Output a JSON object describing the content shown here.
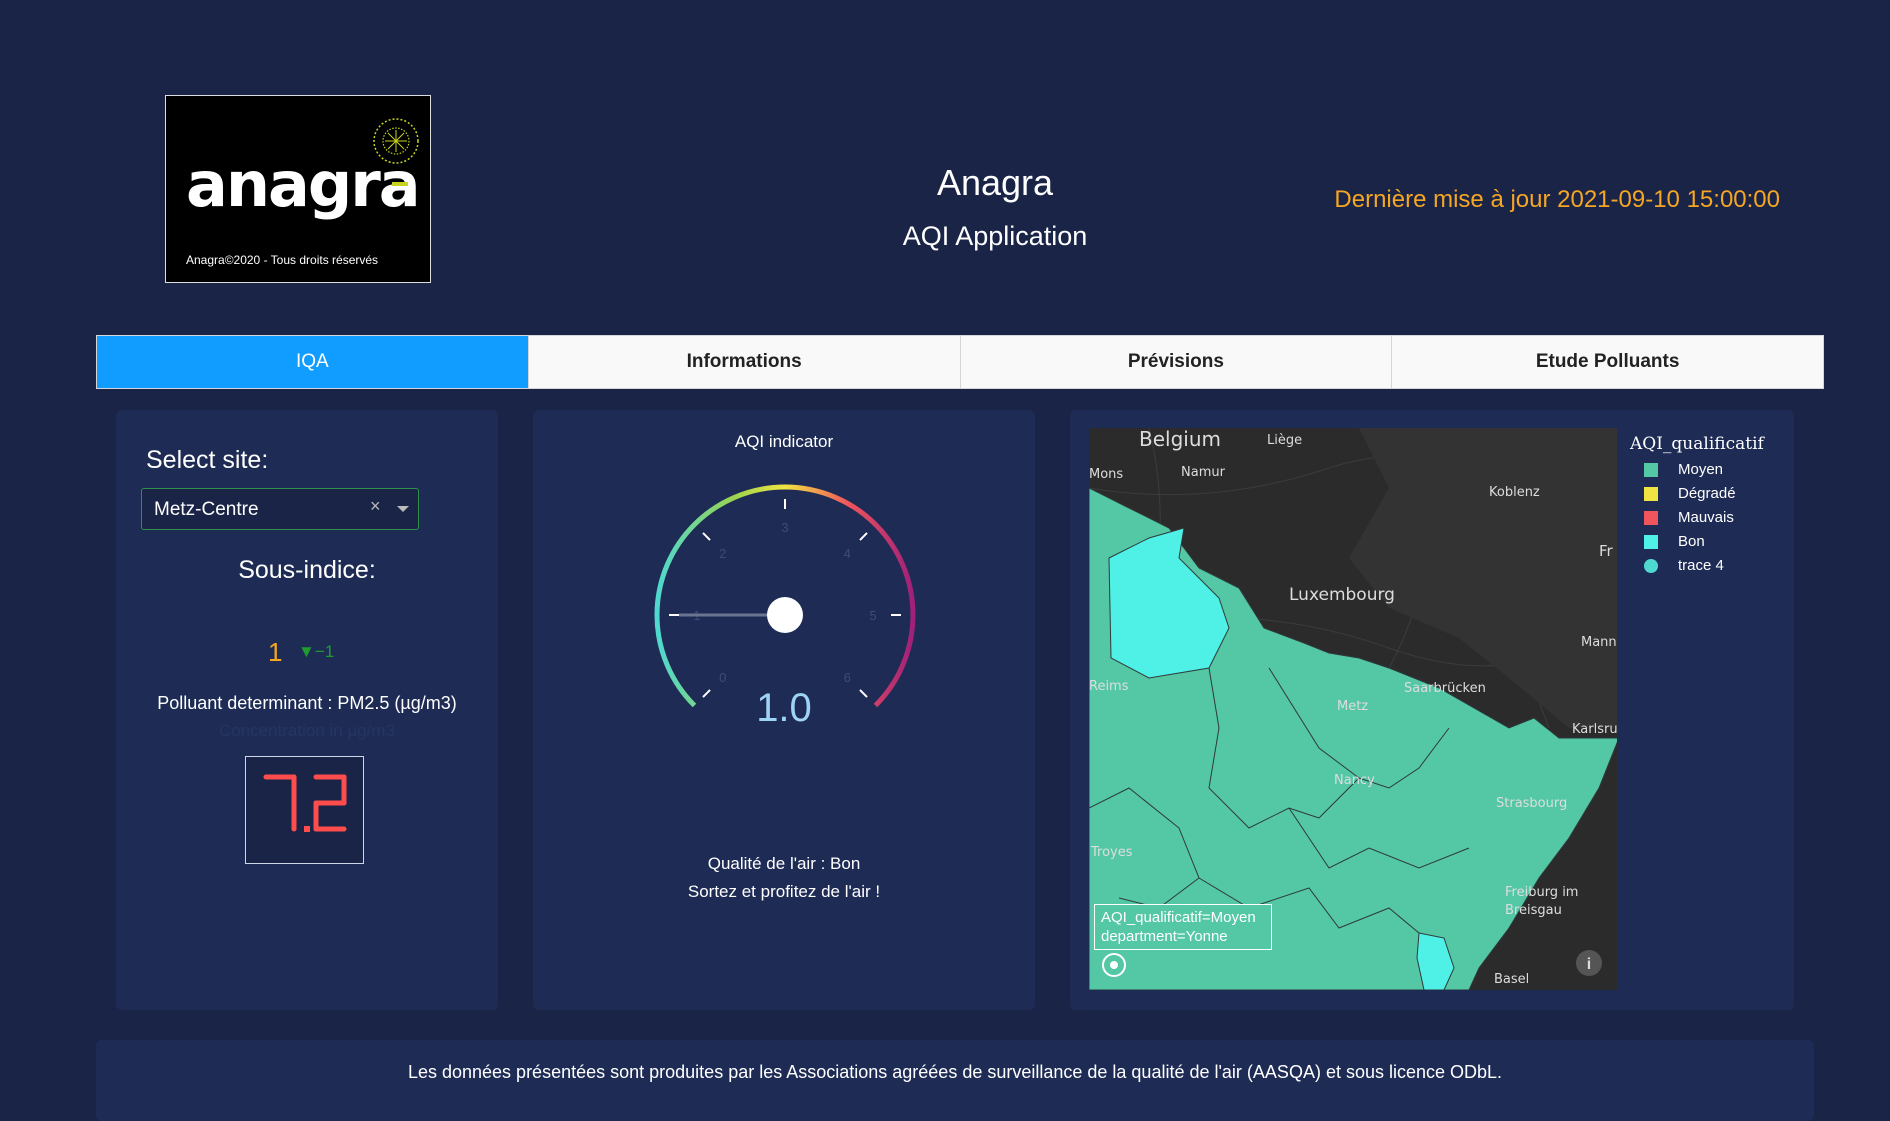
{
  "header": {
    "logo_text": "anagra",
    "logo_copyright": "Anagra©2020 -  Tous droits réservés",
    "title": "Anagra",
    "subtitle": "AQI Application",
    "last_update": "Dernière mise à jour 2021-09-10 15:00:00"
  },
  "tabs": [
    {
      "label": "IQA",
      "active": true
    },
    {
      "label": "Informations",
      "active": false
    },
    {
      "label": "Prévisions",
      "active": false
    },
    {
      "label": "Etude Polluants",
      "active": false
    }
  ],
  "left_panel": {
    "select_label": "Select site:",
    "selected_site": "Metz-Centre",
    "clear_symbol": "×",
    "subindex_label": "Sous-indice:",
    "subindex_value": "1",
    "subindex_delta": "▼−1",
    "pollutant": "Polluant determinant : PM2.5 (µg/m3)",
    "concentration_label": "Concentration in µg/m3",
    "concentration_value": "7.2",
    "led_color": "#ff4d4d"
  },
  "gauge": {
    "title": "AQI indicator",
    "value": 1,
    "value_text": "1.0",
    "min": 0,
    "max": 6,
    "ticks": [
      "0",
      "1",
      "2",
      "3",
      "4",
      "5",
      "6"
    ],
    "quality": "Qualité de l'air : Bon",
    "advice": "Sortez et profitez de l'air !"
  },
  "map": {
    "legend_title": "AQI_qualificatif",
    "legend": [
      {
        "label": "Moyen",
        "color": "#54c7a5",
        "shape": "square"
      },
      {
        "label": "Dégradé",
        "color": "#f0e442",
        "shape": "square"
      },
      {
        "label": "Mauvais",
        "color": "#f0545c",
        "shape": "square"
      },
      {
        "label": "Bon",
        "color": "#4ff0e6",
        "shape": "square"
      },
      {
        "label": "trace 4",
        "color": "#4fd8d0",
        "shape": "circle"
      }
    ],
    "place_labels": [
      "Belgium",
      "Liège",
      "Mons",
      "Namur",
      "Koblenz",
      "Fr",
      "Luxembourg",
      "Mannl",
      "Reims",
      "Saarbrücken",
      "Metz",
      "Karlsru",
      "Nancy",
      "Strasbourg",
      "Troyes",
      "Freiburg im",
      "Breisgau",
      "Basel"
    ],
    "tooltip_line1": "AQI_qualificatif=Moyen",
    "tooltip_line2": "department=Yonne"
  },
  "footer": {
    "text": "Les données présentées sont produites par les Associations agréées de surveillance de la qualité de l'air (AASQA) et sous licence ODbL."
  }
}
